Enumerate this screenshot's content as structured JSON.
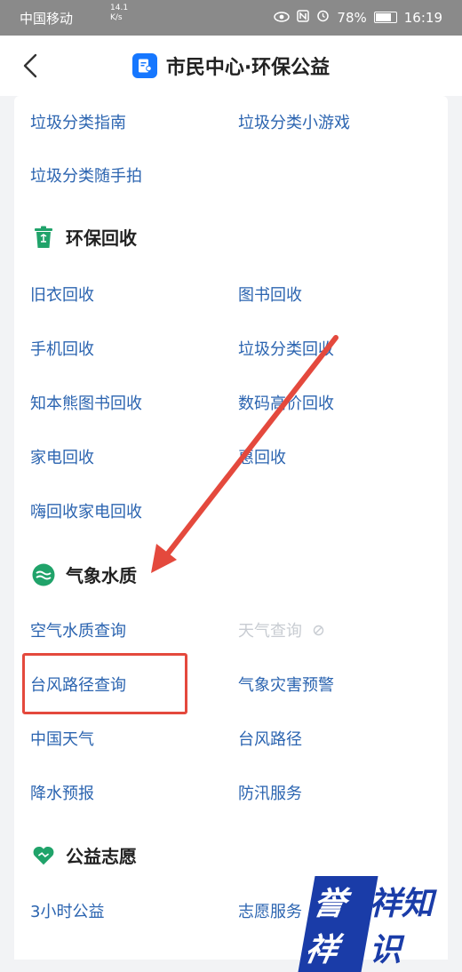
{
  "status_bar": {
    "carrier": "中国移动",
    "net_speed_top": "14.1",
    "net_speed_bottom": "K/s",
    "battery": "78%",
    "time": "16:19"
  },
  "titlebar": {
    "title": "市民中心·环保公益"
  },
  "sections": {
    "garbage": {
      "items": [
        "垃圾分类指南",
        "垃圾分类小游戏",
        "垃圾分类随手拍"
      ]
    },
    "recycle": {
      "title": "环保回收",
      "items": [
        "旧衣回收",
        "图书回收",
        "手机回收",
        "垃圾分类回收",
        "知本熊图书回收",
        "数码高价回收",
        "家电回收",
        "惠回收",
        "嗨回收家电回收"
      ]
    },
    "weather": {
      "title": "气象水质",
      "items": [
        "空气水质查询",
        "天气查询",
        "台风路径查询",
        "气象灾害预警",
        "中国天气",
        "台风路径",
        "降水预报",
        "防汛服务"
      ]
    },
    "charity": {
      "title": "公益志愿",
      "items": [
        "3小时公益",
        "志愿服务"
      ]
    }
  },
  "watermark": {
    "badge": "誉祥",
    "rest": "祥知识"
  },
  "colors": {
    "link": "#2b64b0",
    "accent_green": "#20a36a",
    "annotation_red": "#e4493d"
  }
}
